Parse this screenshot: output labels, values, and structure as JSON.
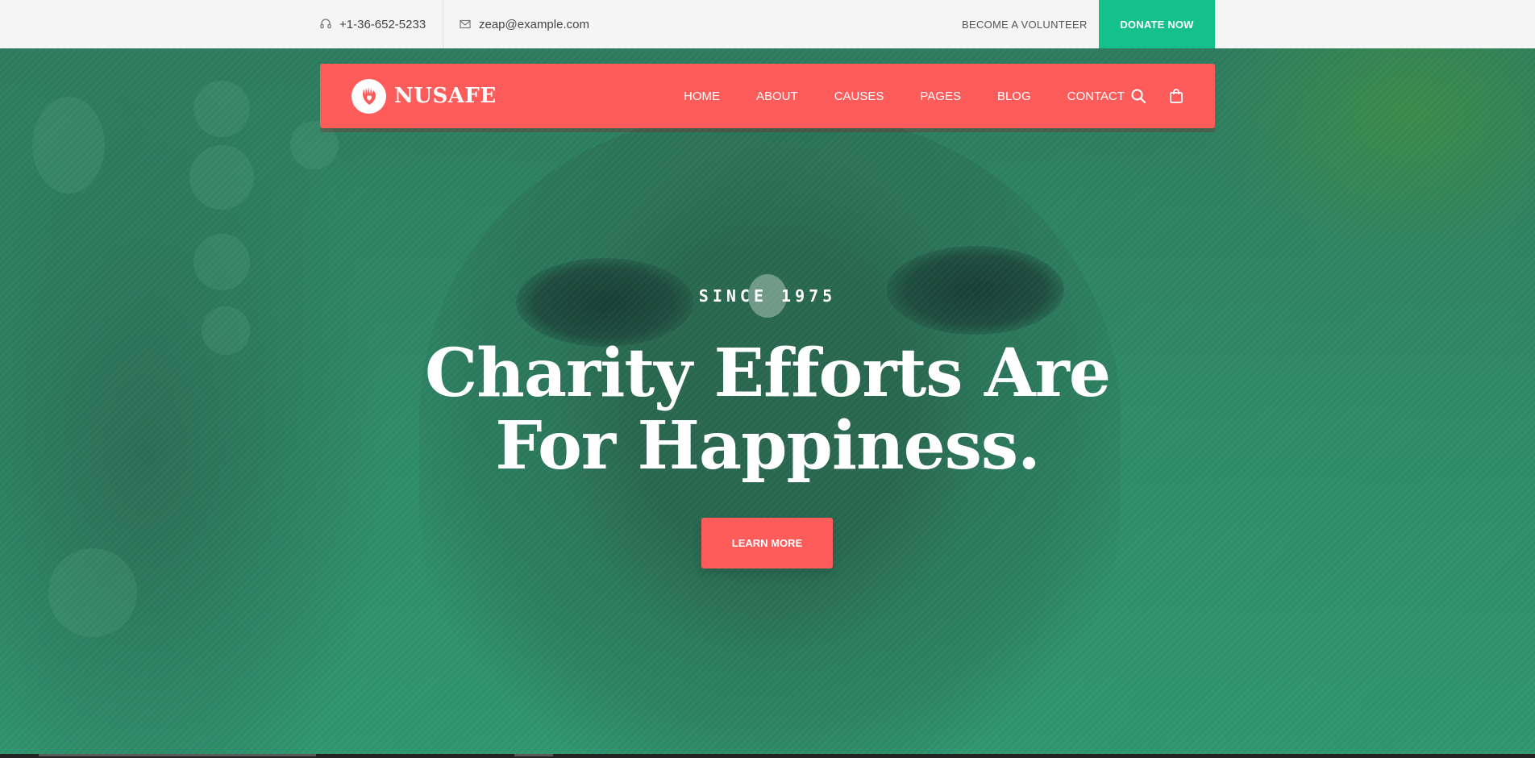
{
  "topbar": {
    "phone": "+1-36-652-5233",
    "email": "zeap@example.com",
    "volunteer_label": "BECOME A VOLUNTEER",
    "donate_label": "DONATE NOW",
    "donate_color": "#14c18d"
  },
  "nav": {
    "brand": "NUSAFE",
    "accent_color": "#fe5c5a",
    "links": [
      "HOME",
      "ABOUT",
      "CAUSES",
      "PAGES",
      "BLOG",
      "CONTACT"
    ],
    "icons": [
      "search-icon",
      "shopping-bag-icon"
    ]
  },
  "hero": {
    "eyebrow": "SINCE 1975",
    "headline_line1": "Charity Efforts Are",
    "headline_line2": "For Happiness.",
    "cta_label": "LEARN MORE",
    "overlay_color": "#2f8f6a"
  }
}
